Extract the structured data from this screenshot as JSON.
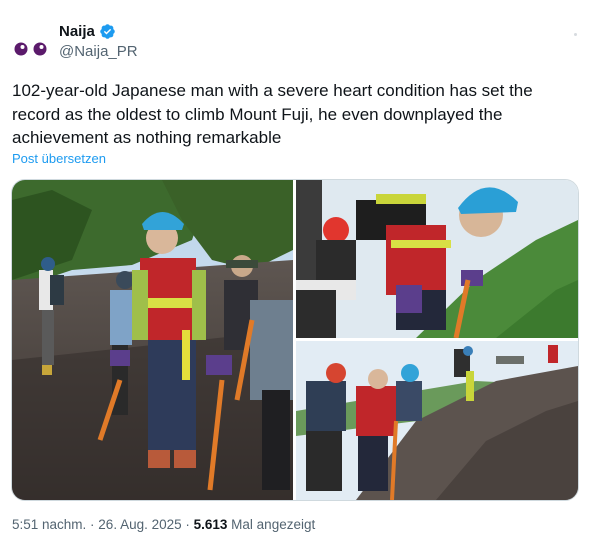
{
  "author": {
    "display_name": "Naija",
    "handle": "@Naija_PR",
    "verified": true,
    "avatar": "twin-eyes-logo"
  },
  "tweet": {
    "text": "102-year-old Japanese man with a severe heart condition has set the record as the oldest to climb Mount Fuji, he even downplayed the achievement as nothing remarkable",
    "translate_label": "Post übersetzen"
  },
  "media": [
    {
      "description": "elderly-man-hiking-with-group",
      "icon": "photo"
    },
    {
      "description": "elderly-man-climbing-close-up",
      "icon": "photo"
    },
    {
      "description": "group-climbing-rocky-slope",
      "icon": "photo"
    }
  ],
  "meta": {
    "time": "5:51 nachm.",
    "separator": " · ",
    "date": "26. Aug. 2025",
    "views_count": "5.613",
    "views_label": " Mal angezeigt"
  },
  "colors": {
    "text": "#0f1419",
    "secondary": "#536471",
    "link": "#1d9bf0",
    "verified": "#1d9bf0",
    "border": "#cfd9de",
    "avatar": "#5b1a6b"
  }
}
